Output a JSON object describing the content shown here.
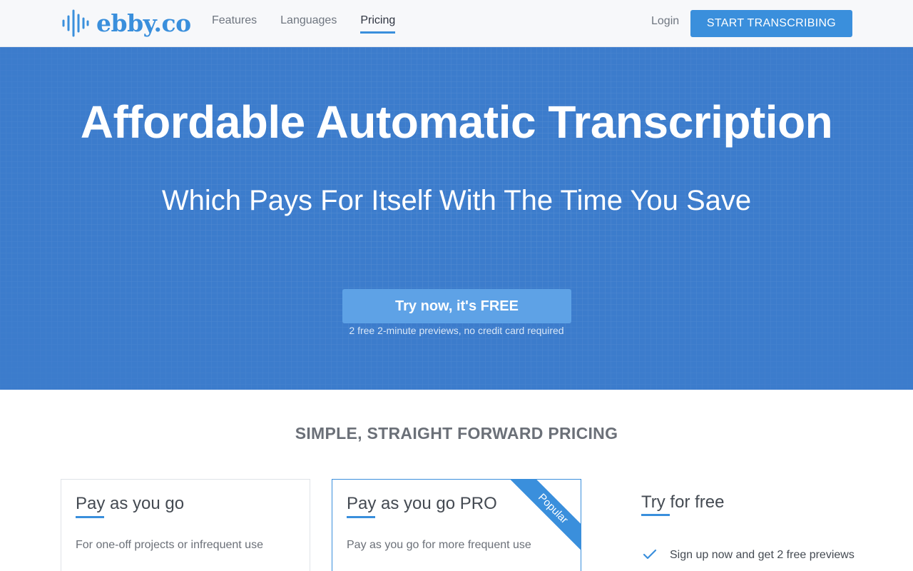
{
  "header": {
    "logo_text": "ebby.co",
    "nav": [
      "Features",
      "Languages",
      "Pricing"
    ],
    "active_nav": "Pricing",
    "login_label": "Login",
    "cta_label": "START TRANSCRIBING"
  },
  "hero": {
    "title": "Affordable Automatic Transcription",
    "subtitle": "Which Pays For Itself With The Time You Save",
    "cta_label": "Try now, it's FREE",
    "note": "2 free 2-minute previews, no credit card required"
  },
  "pricing": {
    "heading": "SIMPLE, STRAIGHT FORWARD PRICING",
    "plans": [
      {
        "title": "Pay as you go",
        "description": "For one-off projects or infrequent use",
        "next_line": ""
      },
      {
        "title": "Pay as you go PRO",
        "description": "Pay as you go for more frequent use",
        "next_line": "",
        "badge": "Popular"
      }
    ],
    "free": {
      "title": "Try for free",
      "items": [
        "Sign up now and get 2 free previews"
      ]
    }
  },
  "colors": {
    "accent": "#3a8fdc",
    "hero_bg": "#3c7ccc",
    "hero_button": "#5ea2e6"
  },
  "icons": {
    "logo": "soundwave-icon",
    "check": "check-icon"
  }
}
